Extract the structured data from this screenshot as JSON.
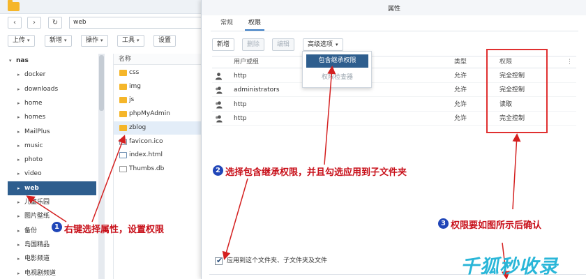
{
  "file_manager": {
    "path": "web",
    "toolbar": [
      {
        "label": "上传",
        "dropdown": true
      },
      {
        "label": "新增",
        "dropdown": true
      },
      {
        "label": "操作",
        "dropdown": true
      },
      {
        "label": "工具",
        "dropdown": true
      },
      {
        "label": "设置",
        "dropdown": false
      }
    ],
    "tree": [
      {
        "label": "nas",
        "root": true
      },
      {
        "label": "docker"
      },
      {
        "label": "downloads"
      },
      {
        "label": "home"
      },
      {
        "label": "homes"
      },
      {
        "label": "MailPlus"
      },
      {
        "label": "music"
      },
      {
        "label": "photo"
      },
      {
        "label": "video"
      },
      {
        "label": "web",
        "selected": true
      },
      {
        "label": "儿童乐园"
      },
      {
        "label": "图片壁纸"
      },
      {
        "label": "备份"
      },
      {
        "label": "岛国精品"
      },
      {
        "label": "电影频道"
      },
      {
        "label": "电视剧频道"
      }
    ],
    "list_header": "名称",
    "files": [
      {
        "name": "css",
        "type": "folder"
      },
      {
        "name": "img",
        "type": "folder"
      },
      {
        "name": "js",
        "type": "folder"
      },
      {
        "name": "phpMyAdmin",
        "type": "folder"
      },
      {
        "name": "zblog",
        "type": "folder",
        "highlight": true
      },
      {
        "name": "favicon.ico",
        "type": "ico"
      },
      {
        "name": "index.html",
        "type": "html"
      },
      {
        "name": "Thumbs.db",
        "type": "db"
      }
    ]
  },
  "dialog": {
    "title": "属性",
    "tabs": [
      {
        "label": "常规",
        "active": false
      },
      {
        "label": "权限",
        "active": true
      }
    ],
    "buttons": [
      {
        "label": "新增",
        "disabled": false
      },
      {
        "label": "删除",
        "disabled": true
      },
      {
        "label": "编辑",
        "disabled": true
      },
      {
        "label": "高级选项",
        "disabled": false,
        "dropdown": true
      }
    ],
    "advanced_menu": [
      "包含继承权限",
      "权限检查器"
    ],
    "table": {
      "headers": [
        "用户或组",
        "类型",
        "权限"
      ],
      "rows": [
        {
          "name": "http",
          "kind": "user",
          "type": "允许",
          "perm": "完全控制"
        },
        {
          "name": "administrators",
          "kind": "group",
          "type": "允许",
          "perm": "完全控制"
        },
        {
          "name": "http",
          "kind": "group",
          "type": "允许",
          "perm": "读取"
        },
        {
          "name": "http",
          "kind": "group",
          "type": "允许",
          "perm": "完全控制"
        }
      ]
    },
    "apply_checkbox": {
      "label": "应用到这个文件夹、子文件夹及文件",
      "checked": true
    }
  },
  "annotations": [
    {
      "num": "1",
      "text": "右键选择属性，设置权限"
    },
    {
      "num": "2",
      "text": "选择包含继承权限，并且勾选应用到子文件夹"
    },
    {
      "num": "3",
      "text": "权限要如图所示后确认"
    }
  ],
  "watermark": "千狐秒收录",
  "colors": {
    "selection": "#2e5e8e",
    "folder": "#f5b62a",
    "annotation_red": "#c8101a",
    "annotation_badge": "#2046b8",
    "watermark": "#29b6d8"
  }
}
